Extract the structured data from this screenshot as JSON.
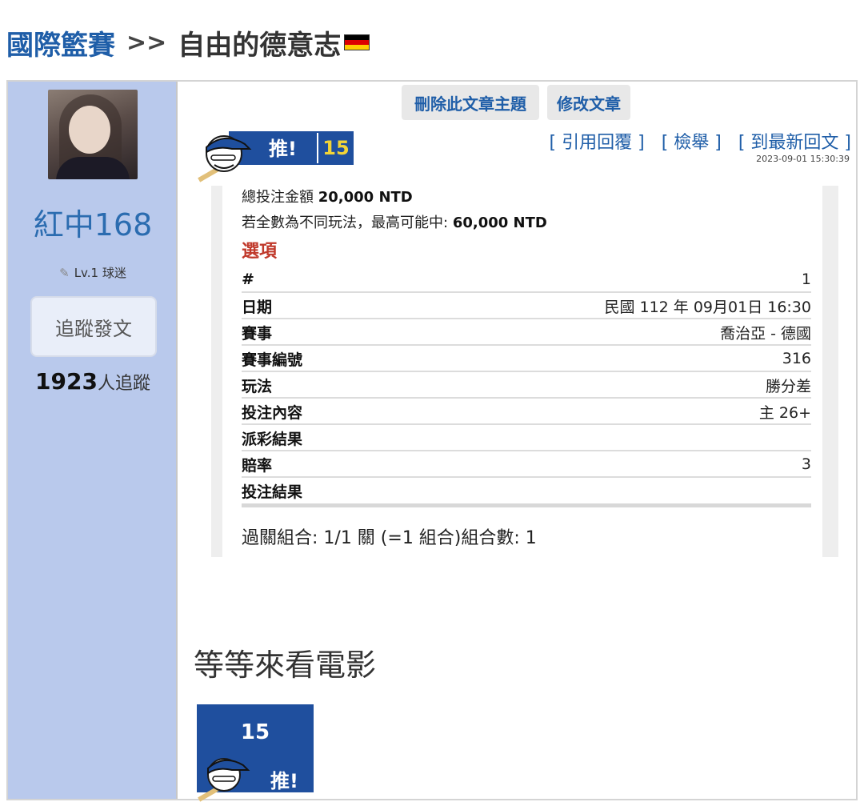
{
  "header": {
    "category": "國際籃賽",
    "separator": ">>",
    "title": "自由的德意志",
    "flag_colors": [
      "#000000",
      "#dd0000",
      "#ffce00"
    ]
  },
  "user": {
    "name": "紅中168",
    "level": "Lv.1 球迷",
    "follow_label": "追蹤發文",
    "followers_count": "1923",
    "followers_suffix": "人追蹤"
  },
  "toolbar": {
    "delete_label": "刪除此文章主題",
    "edit_label": "修改文章"
  },
  "post": {
    "push_label": "推!",
    "push_count": "15",
    "actions": {
      "quote": "[ 引用回覆 ]",
      "report": "[ 檢舉 ]",
      "latest": "[ 到最新回文 ]"
    },
    "timestamp": "2023-09-01 15:30:39",
    "bet": {
      "total_label": "總投注金額",
      "total_value": "20,000 NTD",
      "max_label": "若全數為不同玩法，最高可能中:",
      "max_value": "60,000 NTD",
      "options_title": "選項",
      "rows": [
        {
          "k": "#",
          "v": "1"
        },
        {
          "k": "日期",
          "v": "民國 112 年 09月01日 16:30"
        },
        {
          "k": "賽事",
          "v": "喬治亞 - 德國"
        },
        {
          "k": "賽事編號",
          "v": "316"
        },
        {
          "k": "玩法",
          "v": "勝分差"
        },
        {
          "k": "投注內容",
          "v": "主 26+"
        },
        {
          "k": "派彩結果",
          "v": ""
        },
        {
          "k": "賠率",
          "v": "3"
        },
        {
          "k": "投注結果",
          "v": ""
        }
      ],
      "combo": "過關組合: 1/1 關 (=1 組合)組合數: 1"
    },
    "text": "等等來看電影",
    "vote_count": "15",
    "vote_label": "推!"
  },
  "colors": {
    "link": "#1f5ea8",
    "sidebar": "#b9c9ec",
    "badge": "#1f4f9e",
    "accent_red": "#c0392b"
  }
}
